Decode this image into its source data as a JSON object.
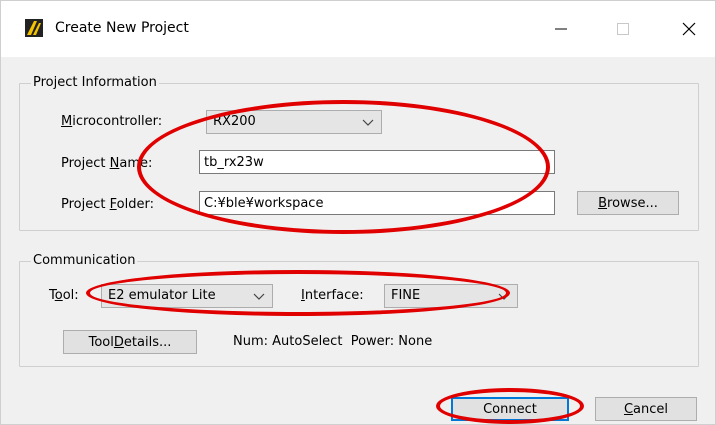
{
  "window": {
    "title": "Create New Project",
    "icon": "renesas-app-icon"
  },
  "project_info": {
    "group_title": "Project Information",
    "microcontroller": {
      "label_key": "M",
      "label_rest": "icrocontroller:",
      "value": "RX200"
    },
    "project_name": {
      "label_pre": "Project ",
      "label_key": "N",
      "label_rest": "ame:",
      "value": "tb_rx23w"
    },
    "project_folder": {
      "label_pre": "Project ",
      "label_key": "F",
      "label_rest": "older:",
      "value": "C:¥ble¥workspace"
    },
    "browse_key": "B",
    "browse_rest": "rowse..."
  },
  "communication": {
    "group_title": "Communication",
    "tool": {
      "label_pre": "T",
      "label_key": "o",
      "label_rest": "ol:",
      "value": "E2 emulator Lite"
    },
    "interface": {
      "label_key": "I",
      "label_rest": "nterface:",
      "value": "FINE"
    },
    "tool_details_pre": "Tool ",
    "tool_details_key": "D",
    "tool_details_rest": "etails...",
    "status": "Num: AutoSelect  Power: None"
  },
  "footer": {
    "connect_label": "Connect",
    "cancel_key": "C",
    "cancel_rest": "ancel"
  },
  "annotations": {
    "color": "#e00000"
  }
}
